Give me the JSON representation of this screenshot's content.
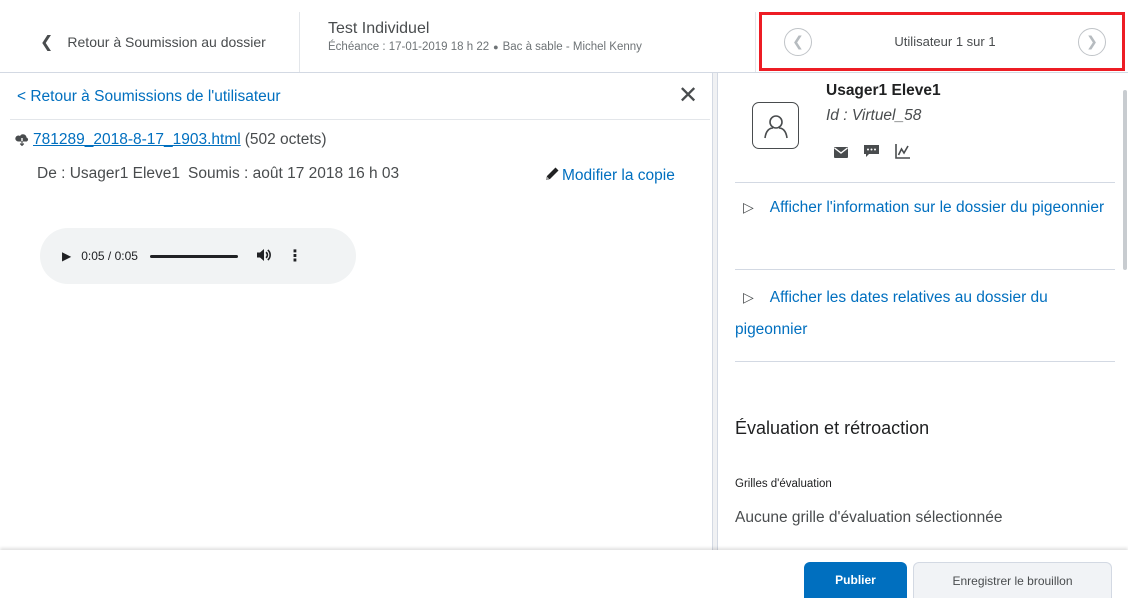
{
  "header": {
    "back_label": "Retour à Soumission au dossier",
    "assignment_title": "Test Individuel",
    "assignment_due": "Échéance : 17-01-2019 18 h 22",
    "assignment_context": "Bac à sable - Michel Kenny",
    "user_count": "Utilisateur 1 sur 1",
    "highlight_color": "#ed1c24"
  },
  "left": {
    "back_label": "< Retour à Soumissions de l'utilisateur",
    "file_name": "781289_2018-8-17_1903.html",
    "file_size": "(502 octets)",
    "from_label": "De : Usager1 Eleve1",
    "submitted_label": "Soumis : août 17 2018 16 h 03",
    "edit_copy_label": "Modifier la copie",
    "audio": {
      "time": "0:05 / 0:05",
      "progress": 1.0
    }
  },
  "right": {
    "user_name": "Usager1 Eleve1",
    "user_id": "Id : Virtuel_58",
    "expander_info": "Afficher l'information sur le dossier du pigeonnier",
    "expander_dates": "Afficher les dates relatives au dossier du pigeonnier",
    "eval_title": "Évaluation et rétroaction",
    "grids_label": "Grilles d'évaluation",
    "no_grid": "Aucune grille d'évaluation sélectionnée"
  },
  "footer": {
    "publish_label": "Publier",
    "draft_label": "Enregistrer le brouillon",
    "accent_color": "#006fbf"
  },
  "icons": {
    "back": "chevron-left-icon",
    "prev_user": "chevron-left-circle-icon",
    "next_user": "chevron-right-circle-icon",
    "close": "close-icon",
    "download": "download-icon",
    "edit": "pencil-icon",
    "avatar": "user-avatar-icon",
    "email": "email-icon",
    "chat": "chat-icon",
    "progress": "chart-icon",
    "expand": "triangle-right-icon"
  }
}
